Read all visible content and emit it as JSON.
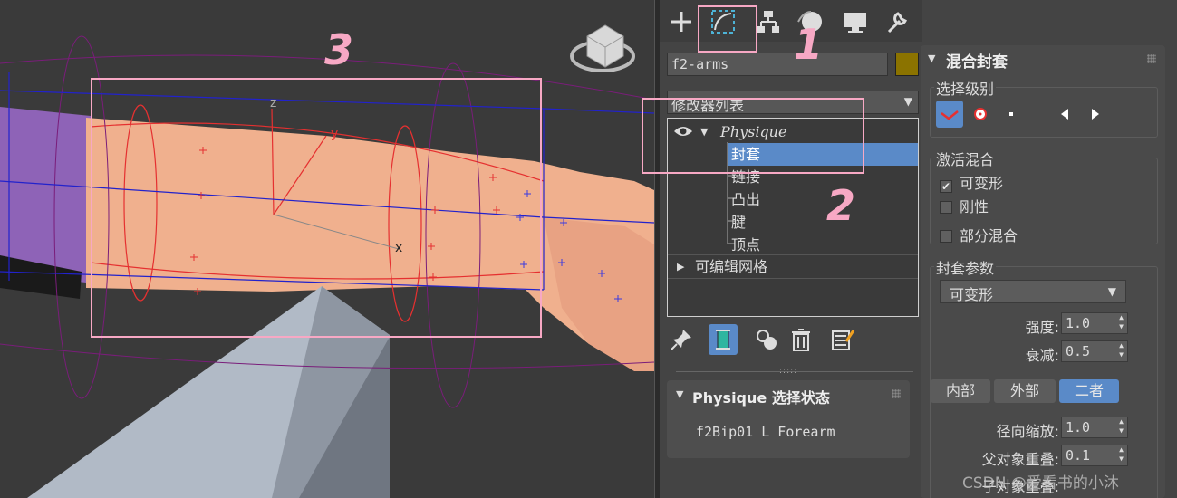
{
  "object_name": "f2-arms",
  "colors": {
    "selection": "#5a8ac8",
    "object_color": "#8b7300",
    "annotation": "#f7a8c4"
  },
  "command_panel": {
    "tabs": [
      "create-icon",
      "modify-icon",
      "hierarchy-icon",
      "motion-icon",
      "display-icon",
      "utilities-icon"
    ],
    "modifier_list_label": "修改器列表",
    "stack": {
      "physique": "Physique",
      "sub_items": [
        "封套",
        "链接",
        "凸出",
        "腱",
        "顶点"
      ],
      "selected_sub": "封套",
      "editable_mesh": "可编辑网格"
    }
  },
  "selection_rollout": {
    "title": "Physique 选择状态",
    "value": "f2Bip01 L Forearm"
  },
  "blend_rollout": {
    "title": "混合封套",
    "selection_level_label": "选择级别",
    "activate_blend_label": "激活混合",
    "checks": [
      {
        "label": "可变形",
        "checked": "✔"
      },
      {
        "label": "刚性",
        "checked": ""
      },
      {
        "label": "部分混合",
        "checked": ""
      }
    ],
    "envelope_params_label": "封套参数",
    "envelope_type": "可变形",
    "strength_label": "强度:",
    "strength_value": "1.0",
    "falloff_label": "衰减:",
    "falloff_value": "0.5",
    "segments": [
      "内部",
      "外部",
      "二者"
    ],
    "active_segment": "二者",
    "radial_scale_label": "径向缩放:",
    "radial_scale_value": "1.0",
    "parent_overlap_label": "父对象重叠:",
    "parent_overlap_value": "0.1",
    "child_overlap_label": "子对象重叠:"
  },
  "viewport": {
    "axis_x": "x",
    "axis_y": "y",
    "axis_z": "z"
  },
  "annotations": [
    "1",
    "2",
    "3"
  ],
  "watermark": "CSDN @爱看书的小沐"
}
